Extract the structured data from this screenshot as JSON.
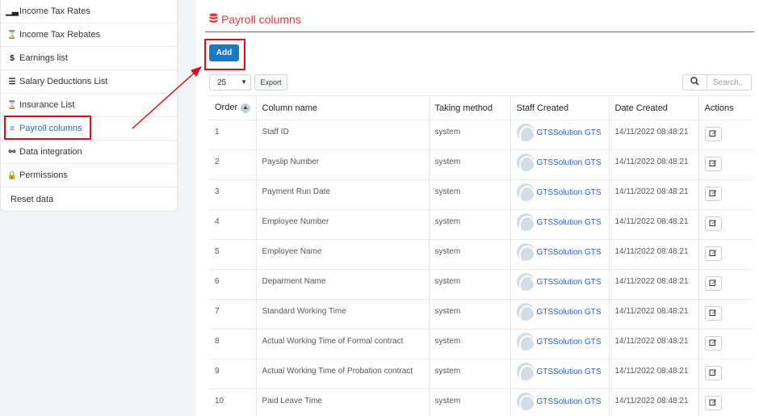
{
  "sidebar": {
    "items": [
      {
        "label": "Income Tax Rates",
        "icon": "chart-area-icon",
        "glyph": "▁▃"
      },
      {
        "label": "Income Tax Rebates",
        "icon": "hourglass-icon",
        "glyph": "⌛"
      },
      {
        "label": "Earnings list",
        "icon": "dollar-icon",
        "glyph": "$"
      },
      {
        "label": "Salary Deductions List",
        "icon": "list-icon",
        "glyph": "☰"
      },
      {
        "label": "Insurance List",
        "icon": "hourglass-icon",
        "glyph": "⌛"
      },
      {
        "label": "Payroll columns",
        "icon": "database-icon",
        "glyph": "≡"
      },
      {
        "label": "Data integration",
        "icon": "unlink-icon",
        "glyph": "⚯"
      },
      {
        "label": "Permissions",
        "icon": "lock-icon",
        "glyph": "🔒"
      },
      {
        "label": "Reset data",
        "icon": "",
        "glyph": ""
      }
    ],
    "active_index": 5
  },
  "main": {
    "title": "Payroll columns",
    "title_icon": "database-icon",
    "add_label": "Add",
    "page_size": "25",
    "export_label": "Export",
    "search_placeholder": "Search.."
  },
  "table": {
    "headers": {
      "order": "Order",
      "name": "Column name",
      "method": "Taking method",
      "staff": "Staff Created",
      "date": "Date Created",
      "actions": "Actions"
    },
    "rows": [
      {
        "order": "1",
        "name": "Staff ID",
        "method": "system",
        "staff": "GTSSolution GTS",
        "date": "14/11/2022 08:48:21"
      },
      {
        "order": "2",
        "name": "Payslip Number",
        "method": "system",
        "staff": "GTSSolution GTS",
        "date": "14/11/2022 08:48:21"
      },
      {
        "order": "3",
        "name": "Payment Run Date",
        "method": "system",
        "staff": "GTSSolution GTS",
        "date": "14/11/2022 08:48:21"
      },
      {
        "order": "4",
        "name": "Employee Number",
        "method": "system",
        "staff": "GTSSolution GTS",
        "date": "14/11/2022 08:48:21"
      },
      {
        "order": "5",
        "name": "Employee Name",
        "method": "system",
        "staff": "GTSSolution GTS",
        "date": "14/11/2022 08:48:21"
      },
      {
        "order": "6",
        "name": "Deparment Name",
        "method": "system",
        "staff": "GTSSolution GTS",
        "date": "14/11/2022 08:48:21"
      },
      {
        "order": "7",
        "name": "Standard Working Time",
        "method": "system",
        "staff": "GTSSolution GTS",
        "date": "14/11/2022 08:48:21"
      },
      {
        "order": "8",
        "name": "Actual Working Time of Formal contract",
        "method": "system",
        "staff": "GTSSolution GTS",
        "date": "14/11/2022 08:48:21"
      },
      {
        "order": "9",
        "name": "Actual Working Time of Probation contract",
        "method": "system",
        "staff": "GTSSolution GTS",
        "date": "14/11/2022 08:48:21"
      },
      {
        "order": "10",
        "name": "Paid Leave Time",
        "method": "system",
        "staff": "GTSSolution GTS",
        "date": "14/11/2022 08:48:21"
      }
    ]
  },
  "colors": {
    "accent": "#1d77c7",
    "title": "#e3393a",
    "highlight": "#e30b17",
    "link": "#2a5fbf"
  }
}
